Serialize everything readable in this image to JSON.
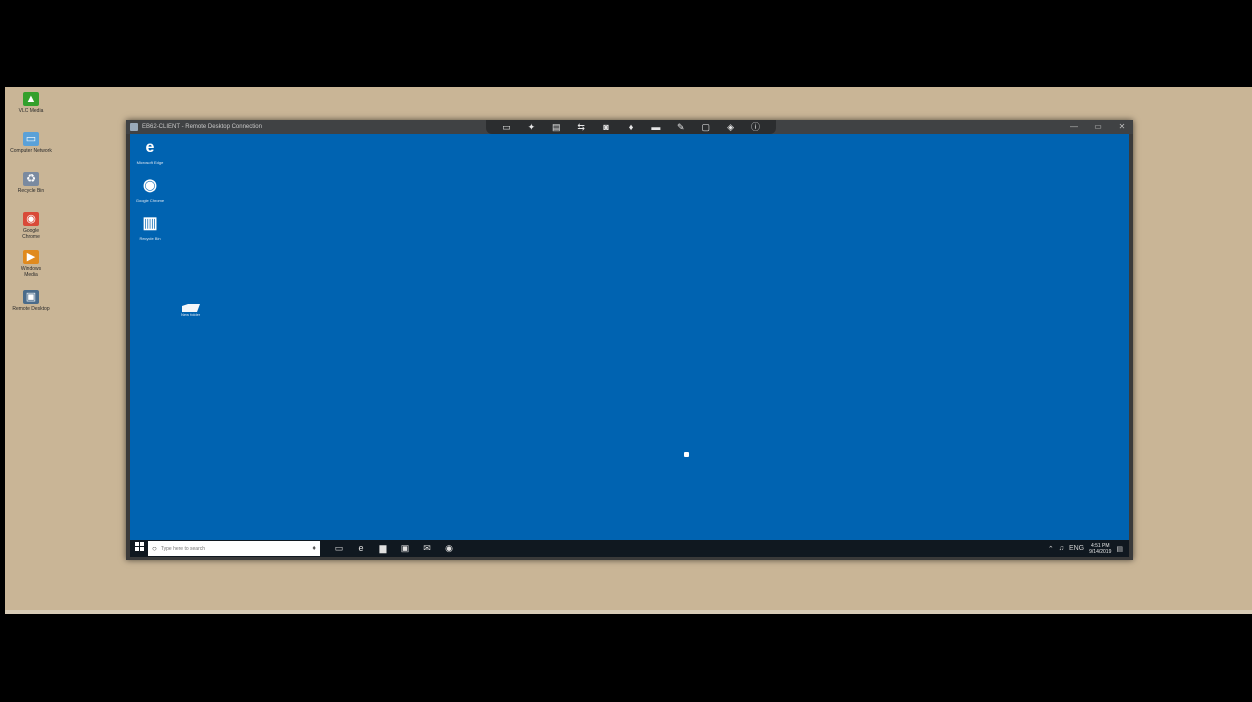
{
  "host": {
    "background": "#c9b596",
    "desktop_icons": [
      {
        "name": "vlc-icon",
        "glyph": "▲",
        "color": "#33a02c",
        "label": "VLC Media"
      },
      {
        "name": "computer-icon",
        "glyph": "▭",
        "color": "#5aa1d8",
        "label": "Computer Network"
      },
      {
        "name": "recycle-bin-icon",
        "glyph": "♻",
        "color": "#7a8aa0",
        "label": "Recycle Bin"
      },
      {
        "name": "chrome-icon",
        "glyph": "◉",
        "color": "#d94a38",
        "label": "Google\nChrome"
      },
      {
        "name": "media-player-icon",
        "glyph": "▶",
        "color": "#e08a1e",
        "label": "Windows\nMedia"
      },
      {
        "name": "remote-desktop-icon",
        "glyph": "▣",
        "color": "#4a6b8a",
        "label": "Remote Desktop"
      }
    ]
  },
  "window": {
    "title": "EB62-CLIENT - Remote Desktop Connection",
    "toolbar": [
      {
        "name": "display-icon",
        "glyph": "▭"
      },
      {
        "name": "pin-icon",
        "glyph": "✦"
      },
      {
        "name": "screen-icon",
        "glyph": "▤"
      },
      {
        "name": "transfer-icon",
        "glyph": "⇆"
      },
      {
        "name": "camera-icon",
        "glyph": "◙"
      },
      {
        "name": "microphone-icon",
        "glyph": "♦"
      },
      {
        "name": "keyboard-icon",
        "glyph": "▬"
      },
      {
        "name": "pen-icon",
        "glyph": "✎"
      },
      {
        "name": "chat-icon",
        "glyph": "▢"
      },
      {
        "name": "settings-icon",
        "glyph": "◈"
      },
      {
        "name": "info-icon",
        "glyph": "ⓘ"
      }
    ],
    "controls": [
      {
        "name": "minimize-icon",
        "glyph": "—"
      },
      {
        "name": "maximize-icon",
        "glyph": "▭"
      },
      {
        "name": "close-icon",
        "glyph": "✕"
      }
    ]
  },
  "remote": {
    "background": "#0063b1",
    "desktop_icons": [
      {
        "name": "edge-icon",
        "glyph": "e",
        "color": "#ffffff",
        "label": "Microsoft Edge"
      },
      {
        "name": "chrome-icon",
        "glyph": "◉",
        "color": "#ffffff",
        "label": "Google Chrome"
      },
      {
        "name": "recycle-bin-icon",
        "glyph": "▥",
        "color": "#ffffff",
        "label": "Recycle Bin"
      }
    ],
    "folder_label": "New folder",
    "taskbar": {
      "search_placeholder": "Type here to search",
      "items": [
        {
          "name": "task-view-icon",
          "glyph": "▭"
        },
        {
          "name": "edge-taskbar-icon",
          "glyph": "e"
        },
        {
          "name": "explorer-icon",
          "glyph": "▆"
        },
        {
          "name": "store-icon",
          "glyph": "▣"
        },
        {
          "name": "mail-icon",
          "glyph": "✉"
        },
        {
          "name": "chrome-taskbar-icon",
          "glyph": "◉"
        }
      ],
      "tray": [
        {
          "name": "network-icon",
          "glyph": "⌃"
        },
        {
          "name": "volume-icon",
          "glyph": "♫"
        },
        {
          "name": "language-icon",
          "glyph": "ENG"
        }
      ],
      "clock": "4:51 PM\n9/14/2019",
      "notification_glyph": "▤"
    }
  }
}
